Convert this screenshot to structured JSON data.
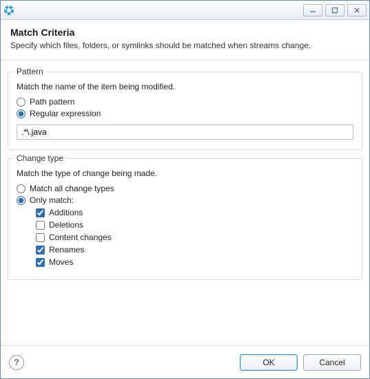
{
  "window": {
    "title_blur": ""
  },
  "header": {
    "title": "Match Criteria",
    "subtitle": "Specify which files, folders, or symlinks should be matched when streams change."
  },
  "pattern": {
    "legend": "Pattern",
    "desc": "Match the name of the item being modified.",
    "path_label": "Path pattern",
    "regex_label": "Regular expression",
    "mode": "regex",
    "value": ".*\\.java"
  },
  "change": {
    "legend": "Change type",
    "desc": "Match the type of change being made.",
    "all_label": "Match all change types",
    "only_label": "Only match:",
    "mode": "only",
    "types": {
      "additions": {
        "label": "Additions",
        "checked": true
      },
      "deletions": {
        "label": "Deletions",
        "checked": false
      },
      "content": {
        "label": "Content changes",
        "checked": false
      },
      "renames": {
        "label": "Renames",
        "checked": true
      },
      "moves": {
        "label": "Moves",
        "checked": true
      }
    }
  },
  "footer": {
    "ok": "OK",
    "cancel": "Cancel"
  }
}
